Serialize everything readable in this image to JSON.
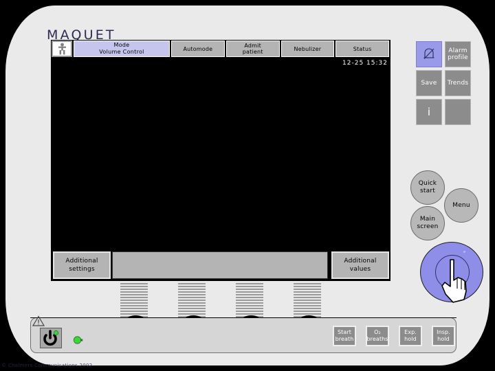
{
  "brand": {
    "name": "MAQUET"
  },
  "screen": {
    "clock": "12-25 15:32",
    "patient_icon": "patient-icon",
    "mode": {
      "label": "Mode",
      "value": "Volume Control"
    },
    "top_buttons": [
      {
        "label": "Automode",
        "name": "automode-button"
      },
      {
        "label_line1": "Admit",
        "label_line2": "patient",
        "name": "admit-patient-button"
      },
      {
        "label": "Nebulizer",
        "name": "nebulizer-button"
      },
      {
        "label": "Status",
        "name": "status-button"
      }
    ],
    "bottom_buttons": {
      "left": {
        "line1": "Additional",
        "line2": "settings"
      },
      "right": {
        "line1": "Additional",
        "line2": "values"
      }
    }
  },
  "right_panel": {
    "alarm_silence": {
      "icon": "bell-slash-icon",
      "name": "alarm-silence-button"
    },
    "alarm_profile": {
      "line1": "Alarm",
      "line2": "profile"
    },
    "save": {
      "label": "Save"
    },
    "trends": {
      "label": "Trends"
    },
    "info": {
      "label": "i"
    },
    "blank": {
      "label": ""
    },
    "quick_start": {
      "line1": "Quick",
      "line2": "start"
    },
    "menu": {
      "label": "Menu"
    },
    "main_screen": {
      "line1": "Main",
      "line2": "screen"
    }
  },
  "lower_panel": {
    "warning_icon": "warning-triangle-icon",
    "power_icon": "power-icon",
    "led": "green-led-indicator",
    "knob_count": 4,
    "action_buttons": [
      {
        "line1": "Start",
        "line2": "breath",
        "name": "start-breath-button"
      },
      {
        "line1": "O₂",
        "line2": "breaths",
        "name": "o2-breaths-button"
      },
      {
        "line1": "Exp.",
        "line2": "hold",
        "name": "exp-hold-button"
      },
      {
        "line1": "Insp.",
        "line2": "hold",
        "name": "insp-hold-button"
      }
    ]
  },
  "footer": {
    "text": "© Chalmers Communications 2002"
  },
  "colors": {
    "bezel": "#eaeaea",
    "screen": "#000000",
    "mode_accent": "#c5c5ee",
    "dial_accent": "#8e8ee8",
    "button_gray": "#b4b4b4",
    "led_green": "#3fd13f"
  }
}
